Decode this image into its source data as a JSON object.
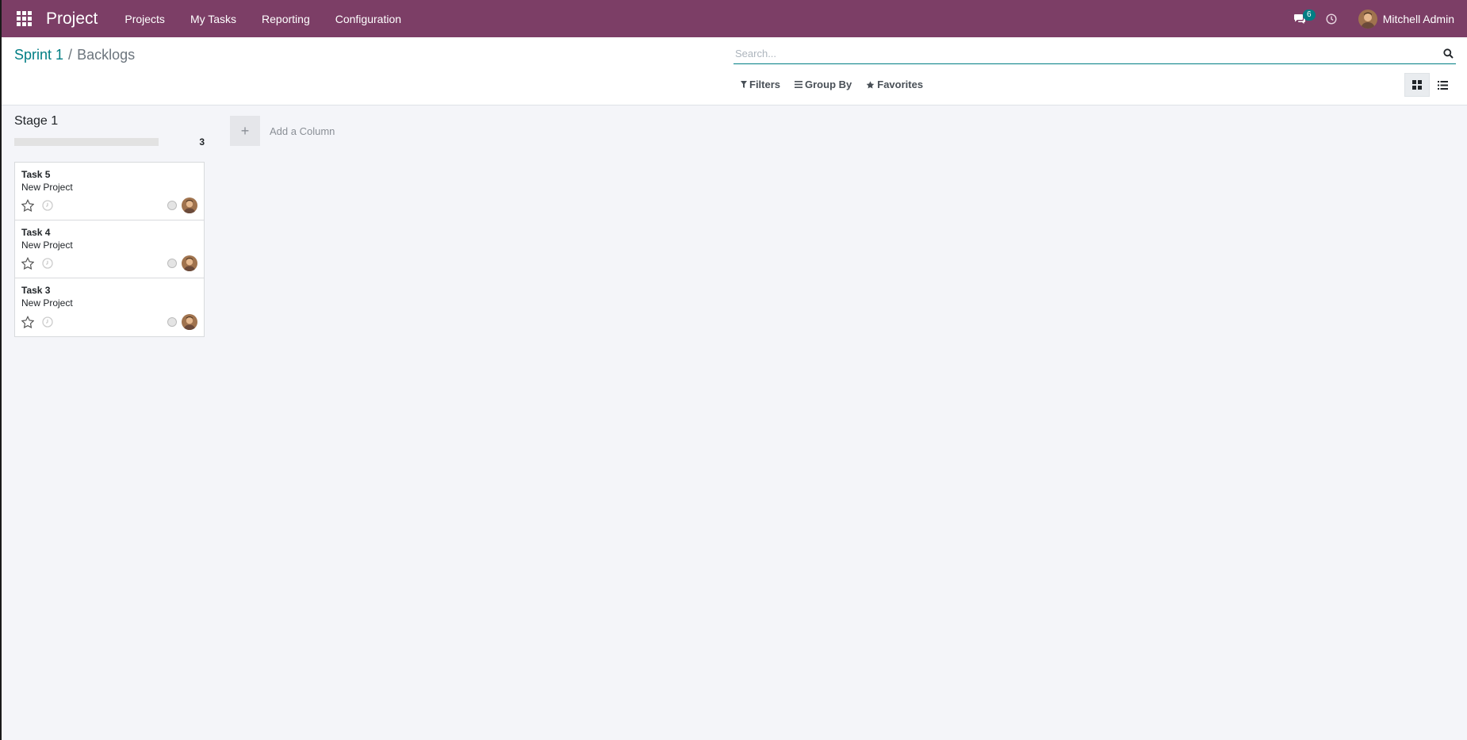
{
  "navbar": {
    "app_name": "Project",
    "menu": [
      {
        "label": "Projects"
      },
      {
        "label": "My Tasks"
      },
      {
        "label": "Reporting"
      },
      {
        "label": "Configuration"
      }
    ],
    "messages_count": "6",
    "user_name": "Mitchell Admin",
    "bg_color": "#7c3e66"
  },
  "breadcrumb": {
    "parent": "Sprint 1",
    "separator": "/",
    "current": "Backlogs"
  },
  "search": {
    "placeholder": "Search...",
    "value": ""
  },
  "filters": {
    "filters_label": "Filters",
    "group_by_label": "Group By",
    "favorites_label": "Favorites"
  },
  "views": {
    "active": "kanban",
    "icons": [
      "kanban-icon",
      "list-icon"
    ]
  },
  "kanban": {
    "columns": [
      {
        "title": "Stage 1",
        "count": "3",
        "progress_fraction": 0,
        "cards": [
          {
            "title": "Task 5",
            "project": "New Project",
            "starred": false
          },
          {
            "title": "Task 4",
            "project": "New Project",
            "starred": false
          },
          {
            "title": "Task 3",
            "project": "New Project",
            "starred": false
          }
        ]
      }
    ],
    "add_column_label": "Add a Column"
  },
  "colors": {
    "accent": "#017e84",
    "navbar": "#7c3e66"
  }
}
